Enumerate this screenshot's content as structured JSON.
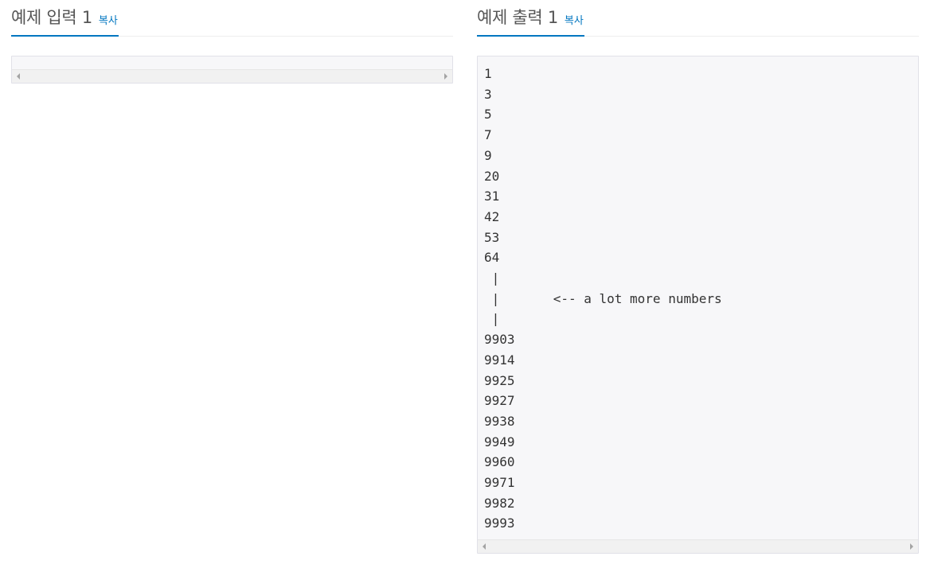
{
  "input_section": {
    "title": "예제 입력 1",
    "copy_label": "복사",
    "content": ""
  },
  "output_section": {
    "title": "예제 출력 1",
    "copy_label": "복사",
    "content": "1\n3\n5\n7\n9\n20\n31\n42\n53\n64\n |\n |       <-- a lot more numbers\n |\n9903\n9914\n9925\n9927\n9938\n9949\n9960\n9971\n9982\n9993"
  },
  "colors": {
    "accent": "#0076c0",
    "box_background": "#f7f7f9",
    "title_text": "#555555"
  }
}
